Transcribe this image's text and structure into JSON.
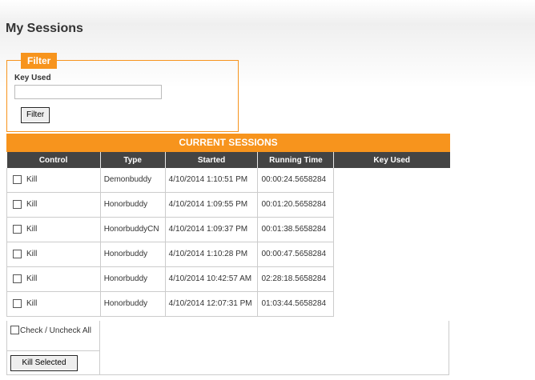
{
  "page": {
    "title": "My Sessions"
  },
  "filter": {
    "legend": "Filter",
    "key_label": "Key Used",
    "key_value": "",
    "button_label": "Filter"
  },
  "sessions": {
    "header": "CURRENT SESSIONS",
    "columns": [
      "Control",
      "Type",
      "Started",
      "Running Time",
      "Key Used"
    ],
    "kill_label": "Kill",
    "rows": [
      {
        "type": "Demonbuddy",
        "started": "4/10/2014 1:10:51 PM",
        "running_time": "00:00:24.5658284",
        "key_used": "",
        "checked": false
      },
      {
        "type": "Honorbuddy",
        "started": "4/10/2014 1:09:55 PM",
        "running_time": "00:01:20.5658284",
        "key_used": "",
        "checked": false
      },
      {
        "type": "HonorbuddyCN",
        "started": "4/10/2014 1:09:37 PM",
        "running_time": "00:01:38.5658284",
        "key_used": "",
        "checked": false
      },
      {
        "type": "Honorbuddy",
        "started": "4/10/2014 1:10:28 PM",
        "running_time": "00:00:47.5658284",
        "key_used": "",
        "checked": false
      },
      {
        "type": "Honorbuddy",
        "started": "4/10/2014 10:42:57 AM",
        "running_time": "02:28:18.5658284",
        "key_used": "",
        "checked": false
      },
      {
        "type": "Honorbuddy",
        "started": "4/10/2014 12:07:31 PM",
        "running_time": "01:03:44.5658284",
        "key_used": "",
        "checked": false
      }
    ],
    "check_all_label": "Check / Uncheck All",
    "kill_selected_label": "Kill Selected"
  }
}
